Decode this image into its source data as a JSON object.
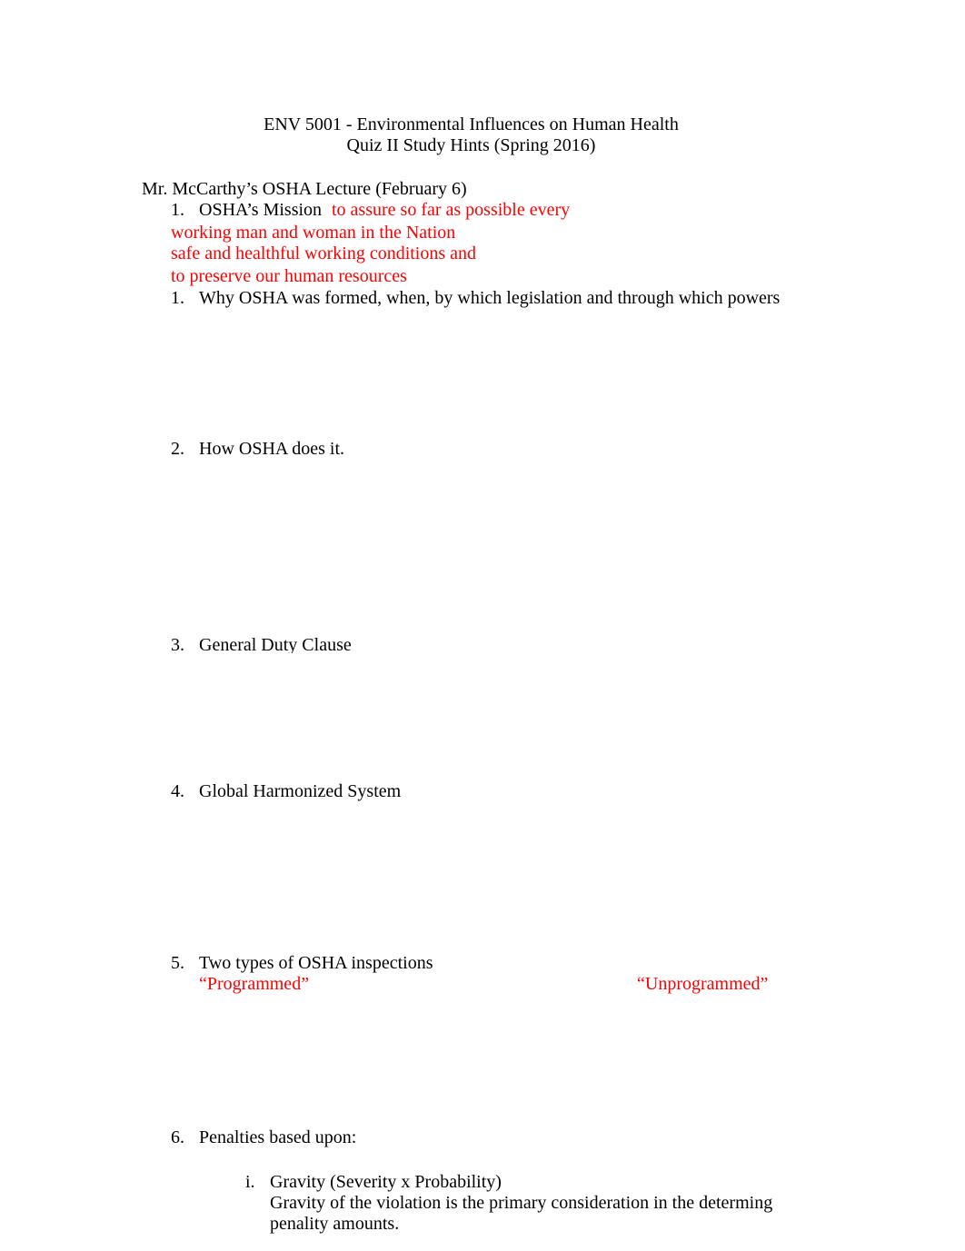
{
  "header": {
    "title": "ENV 5001 - Environmental Influences on Human Health",
    "subtitle": "Quiz II Study Hints (Spring 2016)"
  },
  "section": {
    "heading": "Mr. McCarthy’s OSHA Lecture (February 6)"
  },
  "mission": {
    "number": "1.",
    "label": "OSHA’s Mission",
    "answer_lines": [
      "to assure so far as possible every",
      "working man and woman in the Nation",
      "safe and healthful working conditions and",
      "to preserve our human resources"
    ]
  },
  "items": [
    {
      "number": "1.",
      "text": "Why OSHA was formed, when, by which legislation and through which powers"
    },
    {
      "number": "2.",
      "text": "How OSHA does it."
    },
    {
      "number": "3.",
      "text": "General Duty Clause"
    },
    {
      "number": "4.",
      "text": "Global Harmonized System"
    },
    {
      "number": "5.",
      "text": "Two types of OSHA inspections",
      "answers": [
        "“Programmed”",
        "“Unprogrammed”"
      ]
    },
    {
      "number": "6.",
      "text": "Penalties based upon:"
    }
  ],
  "subitems": [
    {
      "number": "i.",
      "text": "Gravity (Severity x Probability)",
      "detail_lines": [
        "Gravity of the violation is the primary consideration in the determing",
        "penality amounts."
      ]
    }
  ],
  "colors": {
    "text": "#000000",
    "answer": "#ff0000"
  }
}
